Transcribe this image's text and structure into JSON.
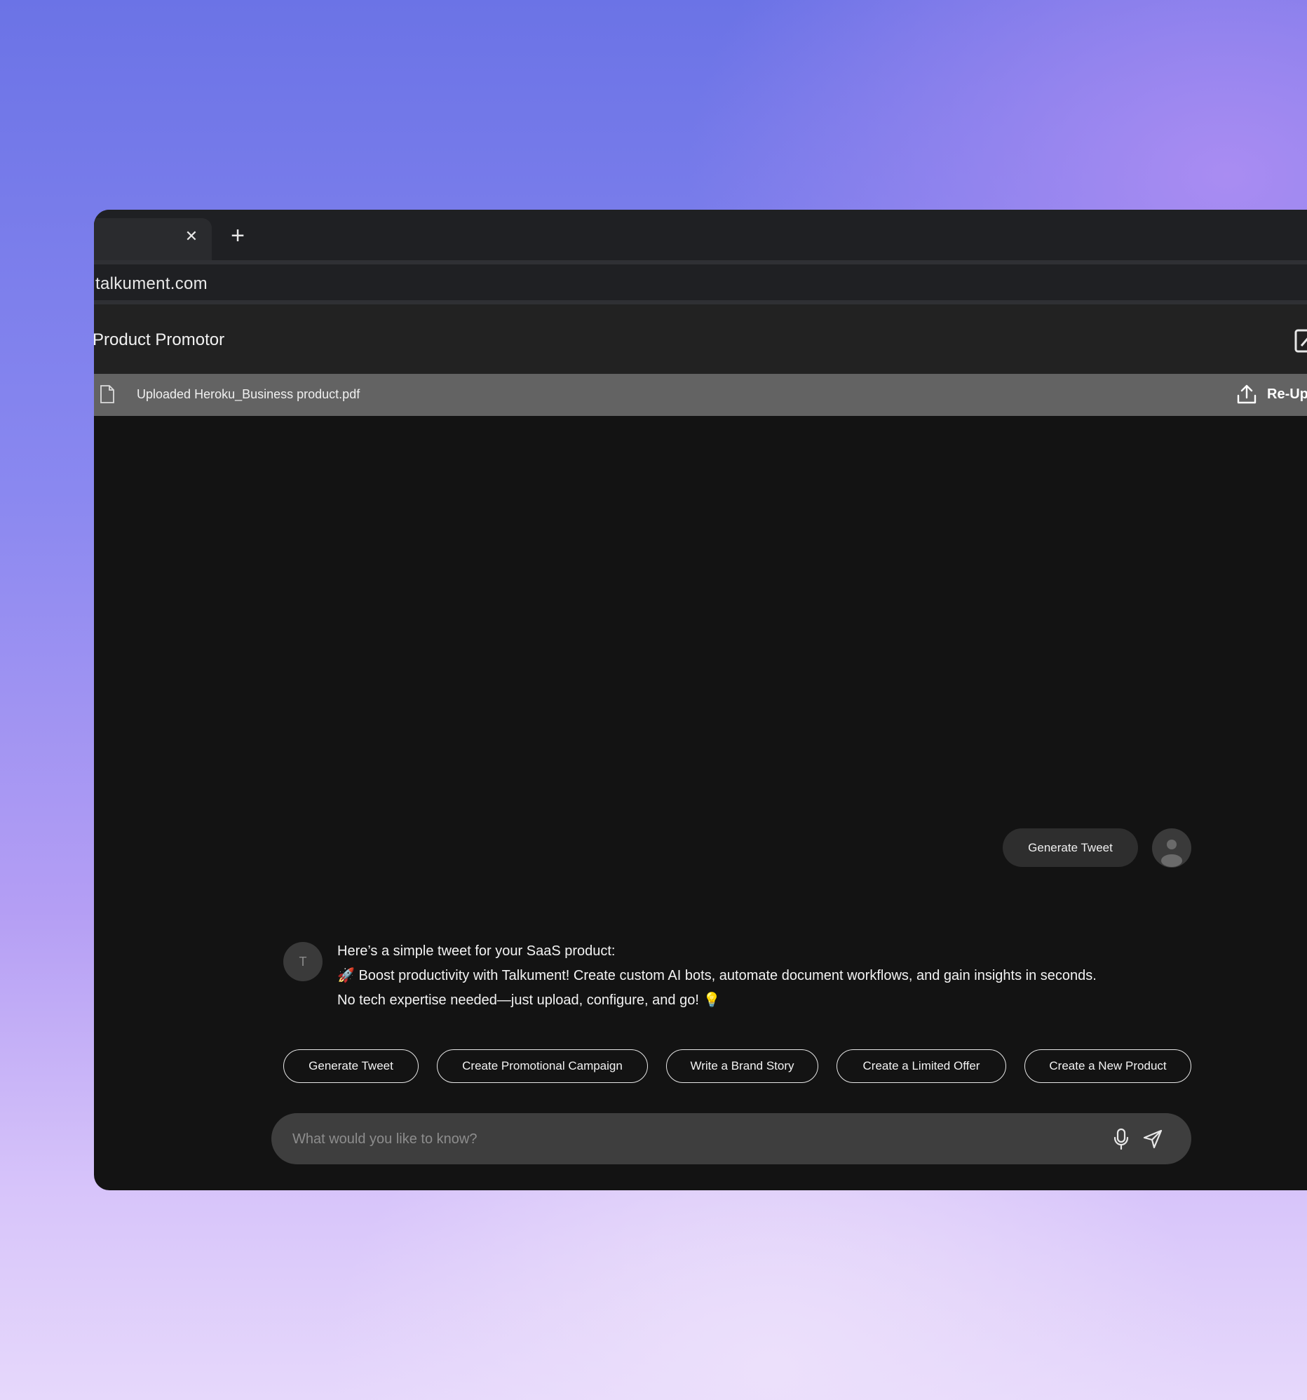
{
  "browser": {
    "tab_close": "✕",
    "new_tab": "+",
    "url": "talkument.com"
  },
  "app": {
    "title": "Product Promotor",
    "file_bar": {
      "label": "Uploaded Heroku_Business product.pdf",
      "reupload_label": "Re-Up"
    }
  },
  "chat": {
    "user_message": "Generate Tweet",
    "bot_avatar_letter": "T",
    "bot_lines": [
      "Here’s a simple tweet for your SaaS product:",
      "🚀 Boost productivity with Talkument! Create custom AI bots, automate document workflows, and gain insights in seconds.",
      "No tech expertise needed—just upload, configure, and go! 💡"
    ]
  },
  "suggestions": [
    "Generate Tweet",
    "Create Promotional Campaign",
    "Write a Brand Story",
    "Create a Limited Offer",
    "Create a New Product"
  ],
  "composer": {
    "placeholder": "What would you like to know?",
    "value": ""
  },
  "icons": [
    "close-icon",
    "plus-icon",
    "edit-icon",
    "file-icon",
    "upload-icon",
    "user-icon",
    "microphone-icon",
    "send-icon"
  ]
}
